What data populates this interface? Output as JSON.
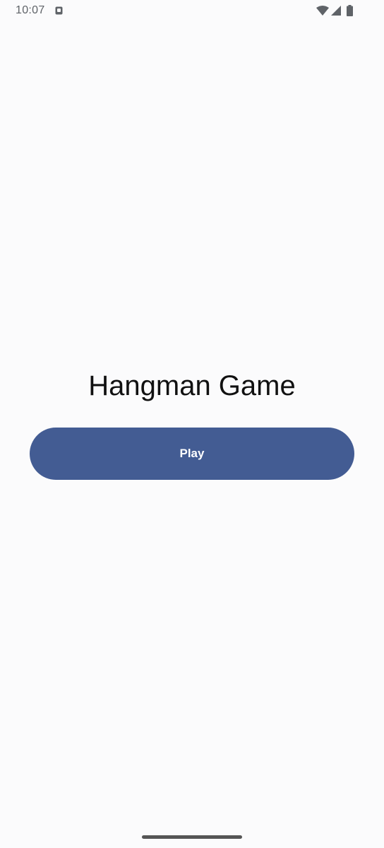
{
  "status_bar": {
    "time": "10:07",
    "icons": [
      "notification-icon",
      "wifi-icon",
      "signal-icon",
      "battery-icon"
    ]
  },
  "main": {
    "title": "Hangman Game",
    "play_label": "Play"
  },
  "colors": {
    "background": "#fbfbfc",
    "button": "#435c93",
    "button_text": "#ffffff",
    "title_text": "#111111",
    "status_text": "#5f6368"
  }
}
